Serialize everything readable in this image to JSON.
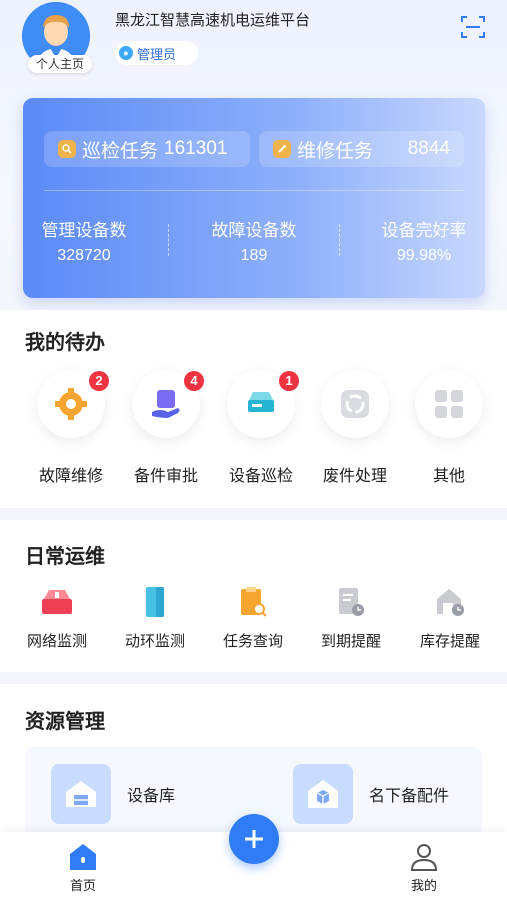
{
  "header": {
    "title": "黑龙江智慧高速机电运维平台",
    "avatar_badge": "个人主页",
    "role": "管理员",
    "icons": {
      "avatar": "user-avatar-icon",
      "scan": "scan-icon"
    }
  },
  "stats": {
    "patrol_label": "巡检任务",
    "patrol_value": "161301",
    "repair_label": "维修任务",
    "repair_value": "8844",
    "items": [
      {
        "label": "管理设备数",
        "value": "328720"
      },
      {
        "label": "故障设备数",
        "value": "189"
      },
      {
        "label": "设备完好率",
        "value": "99.98%"
      }
    ]
  },
  "todo": {
    "title": "我的待办",
    "items": [
      {
        "label": "故障维修",
        "badge": "2",
        "icon": "wrench-gear-icon"
      },
      {
        "label": "备件审批",
        "badge": "4",
        "icon": "hand-document-icon"
      },
      {
        "label": "设备巡检",
        "badge": "1",
        "icon": "server-device-icon"
      },
      {
        "label": "废件处理",
        "badge": "",
        "icon": "recycle-icon"
      },
      {
        "label": "其他",
        "badge": "",
        "icon": "grid-icon"
      }
    ]
  },
  "daily": {
    "title": "日常运维",
    "items": [
      {
        "label": "网络监测",
        "icon": "network-server-icon"
      },
      {
        "label": "动环监测",
        "icon": "cabinet-icon"
      },
      {
        "label": "任务查询",
        "icon": "clipboard-search-icon"
      },
      {
        "label": "到期提醒",
        "icon": "document-clock-icon"
      },
      {
        "label": "库存提醒",
        "icon": "warehouse-clock-icon"
      }
    ]
  },
  "resources": {
    "title": "资源管理",
    "items": [
      {
        "label": "设备库",
        "icon": "warehouse-icon"
      },
      {
        "label": "名下备配件",
        "icon": "box-icon"
      }
    ]
  },
  "tabbar": {
    "home": "首页",
    "mine": "我的",
    "add_icon": "plus-icon"
  },
  "colors": {
    "primary": "#2f7cf6",
    "badge": "#ef3340",
    "card_start": "#5b8af7"
  }
}
